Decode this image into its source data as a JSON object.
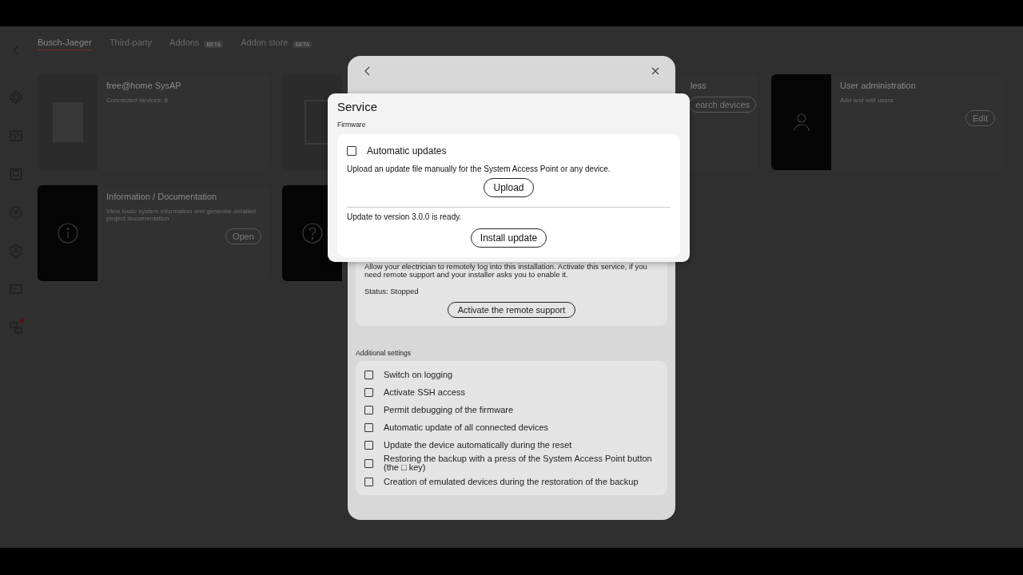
{
  "tabs": [
    {
      "label": "Busch-Jaeger",
      "selected": true
    },
    {
      "label": "Third-party",
      "selected": false
    },
    {
      "label": "Addons",
      "badge": "BETA",
      "selected": false
    },
    {
      "label": "Addon store",
      "badge": "BETA",
      "selected": false
    }
  ],
  "sidebar": {
    "items": [
      {
        "alert": false
      },
      {
        "alert": false
      },
      {
        "alert": false
      },
      {
        "alert": false
      },
      {
        "alert": false
      },
      {
        "alert": false
      },
      {
        "alert": true
      }
    ]
  },
  "cards": [
    {
      "kind": "device",
      "title": "free@home SysAP",
      "subtitle": "Connected devices: 6"
    },
    {
      "kind": "switch"
    },
    {
      "kind": "hidden",
      "title": "less",
      "button": "earch devices"
    },
    {
      "kind": "user",
      "title": "User administration",
      "subtitle": "Add and edit users",
      "button": "Edit"
    },
    {
      "kind": "info",
      "title": "Information / Documentation",
      "subtitle": "View basic system information and generate detailed project documentation",
      "button": "Open"
    },
    {
      "kind": "help"
    }
  ],
  "back_dialog": {
    "remote_support": {
      "text": "Allow your electrician to remotely log into this installation. Activate this service, if you need remote support and your installer asks you to enable it.",
      "status": "Status: Stopped",
      "button": "Activate the remote support"
    },
    "additional_settings": {
      "label": "Additional settings",
      "options": [
        {
          "label": "Switch on logging",
          "checked": false
        },
        {
          "label": "Activate SSH access",
          "checked": false
        },
        {
          "label": "Permit debugging of the firmware",
          "checked": false
        },
        {
          "label": "Automatic update of all connected devices",
          "checked": false
        },
        {
          "label": "Update the device automatically during the reset",
          "checked": false
        },
        {
          "label": "Restoring the backup with a press of the System Access Point button (the □ key)",
          "checked": false
        },
        {
          "label": "Creation of emulated devices during the restoration of the backup",
          "checked": false
        }
      ]
    }
  },
  "dialog": {
    "title": "Service",
    "section": "Firmware",
    "auto_updates": {
      "label": "Automatic updates",
      "checked": false
    },
    "upload_text": "Upload an update file manually for the System Access Point or any device.",
    "upload_button": "Upload",
    "update_text": "Update to version 3.0.0 is ready.",
    "install_button": "Install update"
  }
}
